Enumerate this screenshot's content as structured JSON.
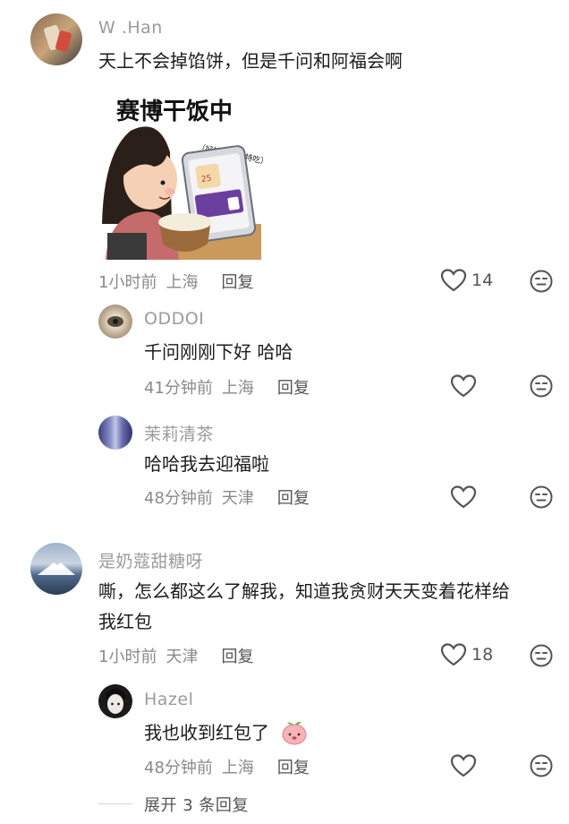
{
  "comments": [
    {
      "user": "W .Han",
      "text": "天上不会掉馅饼，但是千问和阿福会啊",
      "sticker": {
        "title": "赛博干饭中",
        "bubble": "（好饭我大吃特吃）",
        "card_number": "25"
      },
      "time": "1小时前",
      "location": "上海",
      "reply_label": "回复",
      "likes": "14",
      "replies": [
        {
          "user": "ODDOI",
          "text": "千问刚刚下好 哈哈",
          "time": "41分钟前",
          "location": "上海",
          "reply_label": "回复"
        },
        {
          "user": "茉莉清茶",
          "text": "哈哈我去迎福啦",
          "time": "48分钟前",
          "location": "天津",
          "reply_label": "回复"
        }
      ]
    },
    {
      "user": "是奶蔻甜糖呀",
      "text_line1": "嘶，怎么都这么了解我，知道我贪财天天变着花样给",
      "text_line2": "我红包",
      "time": "1小时前",
      "location": "天津",
      "reply_label": "回复",
      "likes": "18",
      "replies": [
        {
          "user": "Hazel",
          "text": "我也收到红包了",
          "time": "48分钟前",
          "location": "上海",
          "reply_label": "回复"
        }
      ],
      "expand_label": "展开 3 条回复"
    }
  ],
  "colors": {
    "name": "#9b9b9b",
    "text": "#1c1c1c",
    "meta": "#8a8a8a",
    "icon": "#555555"
  }
}
